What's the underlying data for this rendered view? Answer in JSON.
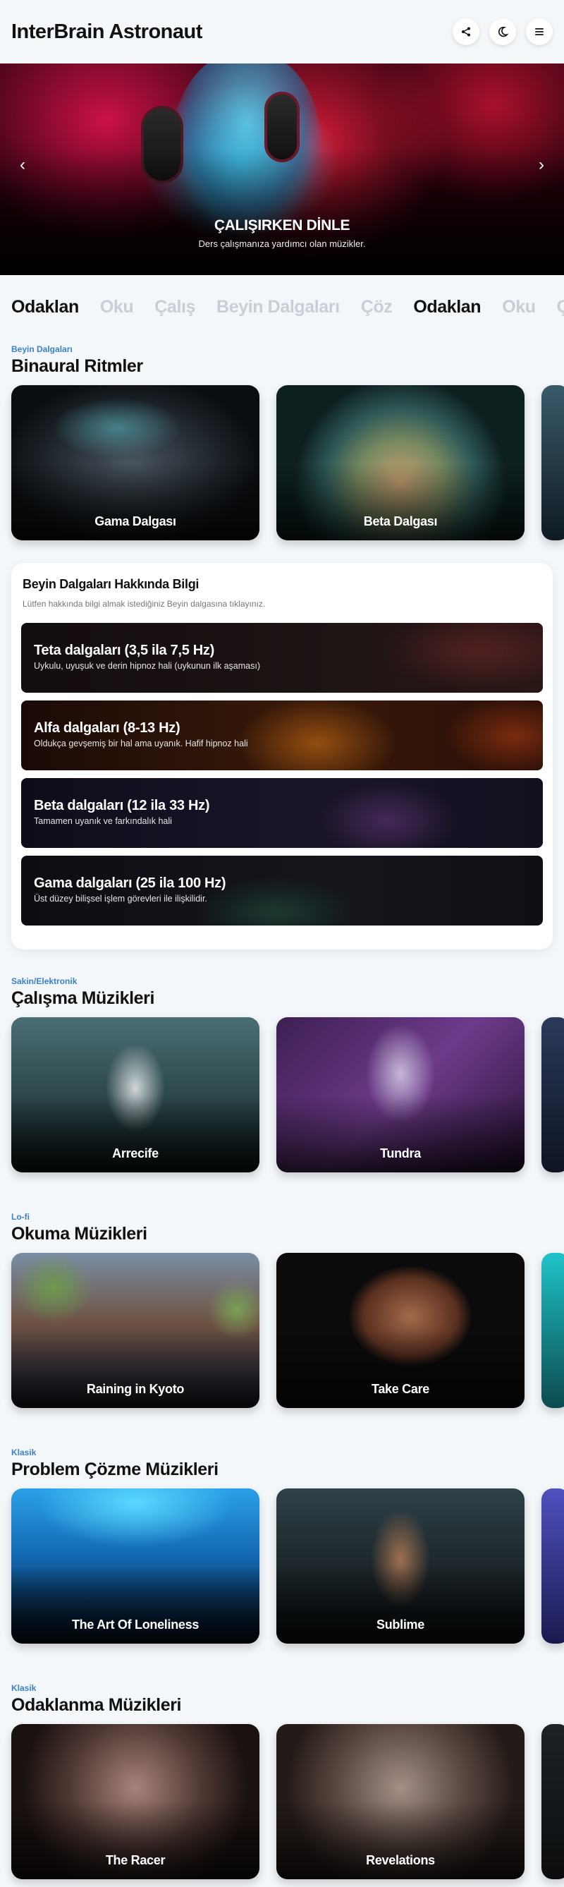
{
  "header": {
    "title": "InterBrain Astronaut",
    "actions": [
      {
        "icon": "share-icon"
      },
      {
        "icon": "moon-icon"
      },
      {
        "icon": "menu-icon"
      }
    ]
  },
  "hero": {
    "title": "ÇALIŞIRKEN DİNLE",
    "subtitle": "Ders çalışmanıza yardımcı olan müzikler.",
    "prev_icon": "‹",
    "next_icon": "›"
  },
  "marquee": {
    "items": [
      {
        "text": "Odaklan",
        "strong": true
      },
      {
        "text": "Oku",
        "strong": false
      },
      {
        "text": "Çalış",
        "strong": false
      },
      {
        "text": "Beyin Dalgaları",
        "strong": false
      },
      {
        "text": "Çöz",
        "strong": false
      },
      {
        "text": "Odaklan",
        "strong": true
      },
      {
        "text": "Oku",
        "strong": false
      },
      {
        "text": "Çalış",
        "strong": false
      }
    ]
  },
  "sections": [
    {
      "kicker": "Beyin Dalgaları",
      "title": "Binaural Ritmler",
      "cards": [
        "Gama Dalgası",
        "Beta Dalgası"
      ]
    },
    {
      "kicker": "Sakin/Elektronik",
      "title": "Çalışma Müzikleri",
      "cards": [
        "Arrecife",
        "Tundra"
      ]
    },
    {
      "kicker": "Lo-fi",
      "title": "Okuma Müzikleri",
      "cards": [
        "Raining in Kyoto",
        "Take Care"
      ]
    },
    {
      "kicker": "Klasik",
      "title": "Problem Çözme Müzikleri",
      "cards": [
        "The Art Of Loneliness",
        "Sublime"
      ]
    },
    {
      "kicker": "Klasik",
      "title": "Odaklanma Müzikleri",
      "cards": [
        "The Racer",
        "Revelations"
      ]
    }
  ],
  "info": {
    "title": "Beyin Dalgaları Hakkında Bilgi",
    "description": "Lütfen hakkında bilgi almak istediğiniz Beyin dalgasına tıklayınız.",
    "waves": [
      {
        "name": "Teta dalgaları (3,5 ila 7,5 Hz)",
        "desc": "Uykulu, uyuşuk ve derin hipnoz hali (uykunun ilk aşaması)"
      },
      {
        "name": "Alfa dalgaları (8-13 Hz)",
        "desc": "Oldukça gevşemiş bir hal ama uyanık. Hafif hipnoz hali"
      },
      {
        "name": "Beta dalgaları (12 ila 33 Hz)",
        "desc": "Tamamen uyanık ve farkındalık hali"
      },
      {
        "name": "Gama dalgaları (25 ila 100 Hz)",
        "desc": "Üst düzey bilişsel işlem görevleri ile ilişkilidir."
      }
    ]
  }
}
